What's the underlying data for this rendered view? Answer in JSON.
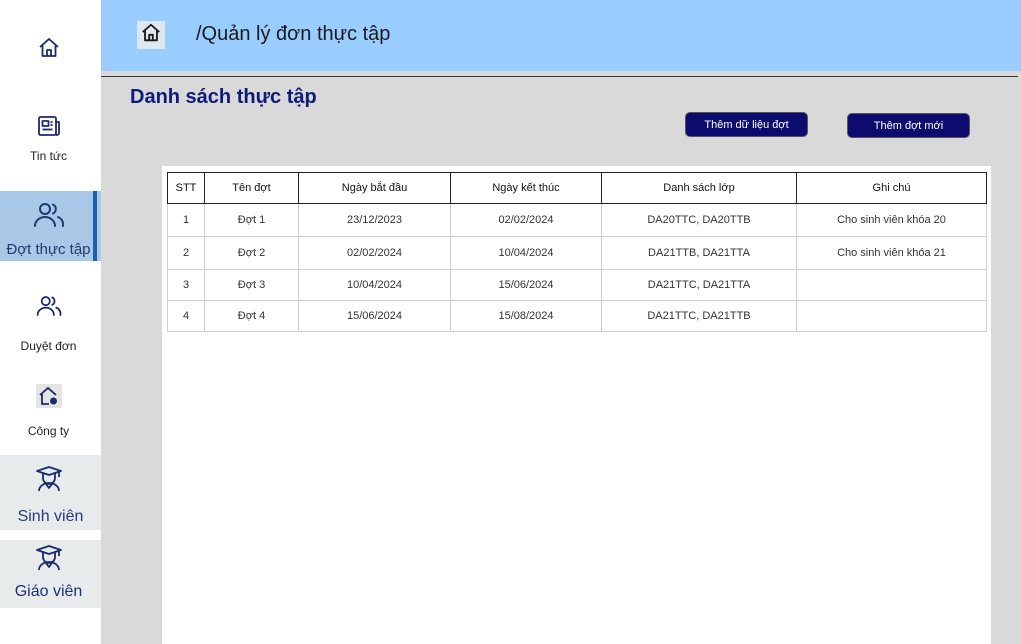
{
  "sidebar": {
    "items": [
      {
        "label": "",
        "icon": "home-icon"
      },
      {
        "label": "Tin tức",
        "icon": "news-icon"
      },
      {
        "label": "Đợt thực tập",
        "icon": "users-icon",
        "active": true
      },
      {
        "label": "Duyệt đơn",
        "icon": "users-icon"
      },
      {
        "label": "Công ty",
        "icon": "company-icon"
      },
      {
        "label": "Sinh viên",
        "icon": "graduate-icon"
      },
      {
        "label": "Giáo viên",
        "icon": "graduate-icon"
      }
    ]
  },
  "header": {
    "title": "/Quản lý đơn thực tập",
    "home_icon": "home-icon"
  },
  "main": {
    "title": "Danh sách thực tập",
    "buttons": {
      "add_data": "Thêm dữ liệu đợt",
      "add_new": "Thêm đợt mới"
    }
  },
  "table": {
    "columns": [
      "STT",
      "Tên đợt",
      "Ngày bắt đầu",
      "Ngày kết thúc",
      "Danh sách lớp",
      "Ghi chú"
    ],
    "rows": [
      [
        "1",
        "Đợt 1",
        "23/12/2023",
        "02/02/2024",
        "DA20TTC, DA20TTB",
        "Cho sinh viên khóa 20"
      ],
      [
        "2",
        "Đợt 2",
        "02/02/2024",
        "10/04/2024",
        "DA21TTB, DA21TTA",
        "Cho sinh viên khóa 21"
      ],
      [
        "3",
        "Đợt 3",
        "10/04/2024",
        "15/06/2024",
        "DA21TTC, DA21TTA",
        ""
      ],
      [
        "4",
        "Đợt 4",
        "15/06/2024",
        "15/08/2024",
        "DA21TTC, DA21TTB",
        ""
      ]
    ]
  },
  "colors": {
    "header_bg": "#99ccff",
    "accent": "#0c0c6e",
    "title": "#0e1b7a",
    "active_nav": "#a9c7e6"
  }
}
